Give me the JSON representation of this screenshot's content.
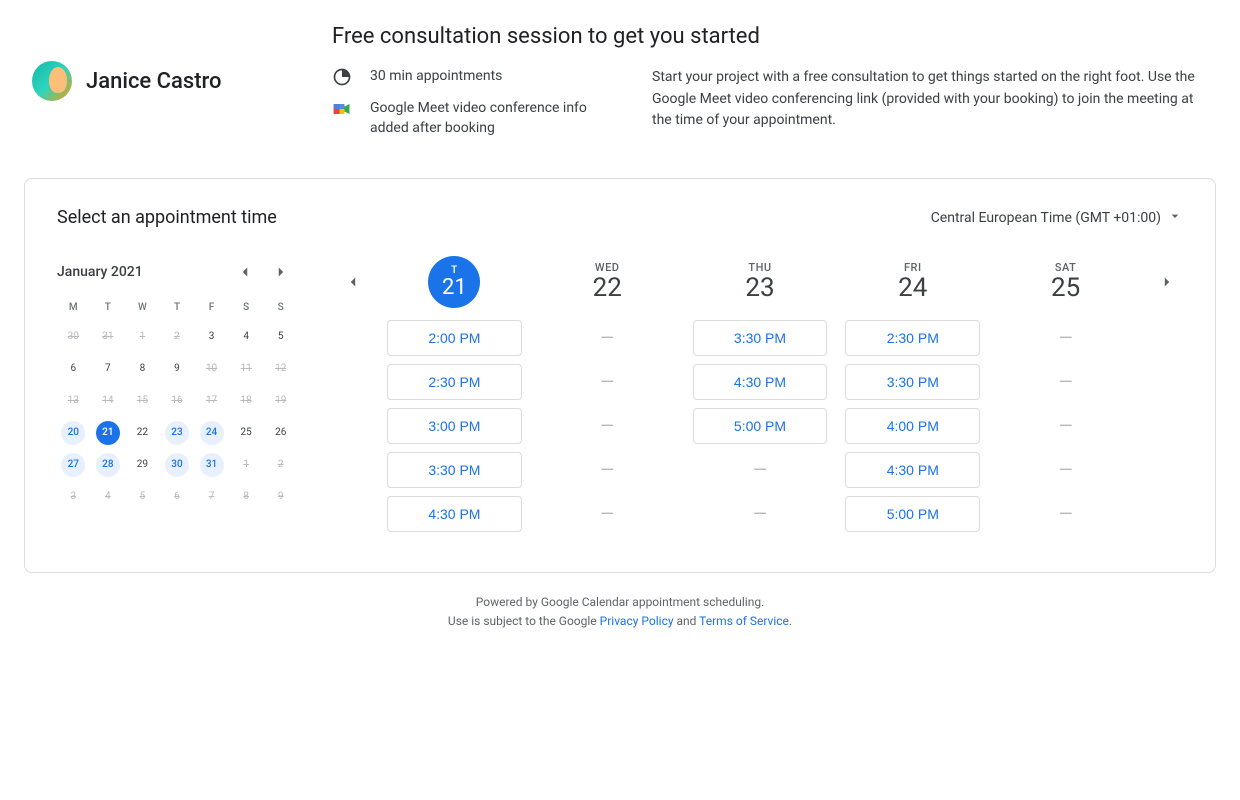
{
  "host": {
    "name": "Janice Castro"
  },
  "title": "Free consultation session to get you started",
  "meta": {
    "duration": "30 min appointments",
    "meet": "Google Meet video conference info added after booking"
  },
  "description": "Start your project with a free consultation to get things started on the right foot. Use the Google Meet video conferencing link (provided with your booking) to join the meeting at the time of your appointment.",
  "card": {
    "title": "Select an appointment time",
    "timezone": "Central European Time (GMT +01:00)"
  },
  "calendar": {
    "month_label": "January 2021",
    "dows": [
      "M",
      "T",
      "W",
      "T",
      "F",
      "S",
      "S"
    ],
    "weeks": [
      [
        {
          "n": 30,
          "t": "prev"
        },
        {
          "n": 31,
          "t": "prev"
        },
        {
          "n": 1,
          "t": "strike"
        },
        {
          "n": 2,
          "t": "strike"
        },
        {
          "n": 3,
          "t": ""
        },
        {
          "n": 4,
          "t": ""
        },
        {
          "n": 5,
          "t": ""
        }
      ],
      [
        {
          "n": 6,
          "t": ""
        },
        {
          "n": 7,
          "t": ""
        },
        {
          "n": 8,
          "t": ""
        },
        {
          "n": 9,
          "t": ""
        },
        {
          "n": 10,
          "t": "strike"
        },
        {
          "n": 11,
          "t": "strike"
        },
        {
          "n": 12,
          "t": "strike"
        }
      ],
      [
        {
          "n": 13,
          "t": "strike"
        },
        {
          "n": 14,
          "t": "strike"
        },
        {
          "n": 15,
          "t": "strike"
        },
        {
          "n": 16,
          "t": "strike"
        },
        {
          "n": 17,
          "t": "strike"
        },
        {
          "n": 18,
          "t": "strike"
        },
        {
          "n": 19,
          "t": "strike"
        }
      ],
      [
        {
          "n": 20,
          "t": "avail"
        },
        {
          "n": 21,
          "t": "selected"
        },
        {
          "n": 22,
          "t": ""
        },
        {
          "n": 23,
          "t": "avail"
        },
        {
          "n": 24,
          "t": "avail"
        },
        {
          "n": 25,
          "t": ""
        },
        {
          "n": 26,
          "t": ""
        }
      ],
      [
        {
          "n": 27,
          "t": "avail"
        },
        {
          "n": 28,
          "t": "avail"
        },
        {
          "n": 29,
          "t": ""
        },
        {
          "n": 30,
          "t": "avail"
        },
        {
          "n": 31,
          "t": "avail"
        },
        {
          "n": 1,
          "t": "next"
        },
        {
          "n": 2,
          "t": "next"
        }
      ],
      [
        {
          "n": 3,
          "t": "next"
        },
        {
          "n": 4,
          "t": "next"
        },
        {
          "n": 5,
          "t": "next"
        },
        {
          "n": 6,
          "t": "next"
        },
        {
          "n": 7,
          "t": "next"
        },
        {
          "n": 8,
          "t": "next"
        },
        {
          "n": 9,
          "t": "next"
        }
      ]
    ]
  },
  "days": [
    {
      "wd": "T",
      "num": "21",
      "selected": true,
      "slots": [
        "2:00 PM",
        "2:30 PM",
        "3:00 PM",
        "3:30 PM",
        "4:30 PM"
      ]
    },
    {
      "wd": "WED",
      "num": "22",
      "selected": false,
      "slots": [
        "—",
        "—",
        "—",
        "—",
        "—"
      ]
    },
    {
      "wd": "THU",
      "num": "23",
      "selected": false,
      "slots": [
        "3:30 PM",
        "4:30 PM",
        "5:00 PM",
        "—",
        "—"
      ]
    },
    {
      "wd": "FRI",
      "num": "24",
      "selected": false,
      "slots": [
        "2:30 PM",
        "3:30 PM",
        "4:00 PM",
        "4:30 PM",
        "5:00 PM"
      ]
    },
    {
      "wd": "SAT",
      "num": "25",
      "selected": false,
      "slots": [
        "—",
        "—",
        "—",
        "—",
        "—"
      ]
    }
  ],
  "footer": {
    "line1": "Powered by Google Calendar appointment scheduling.",
    "line2_a": "Use is subject to the Google ",
    "privacy": "Privacy Policy",
    "and": " and ",
    "tos": "Terms of Service",
    "period": "."
  }
}
